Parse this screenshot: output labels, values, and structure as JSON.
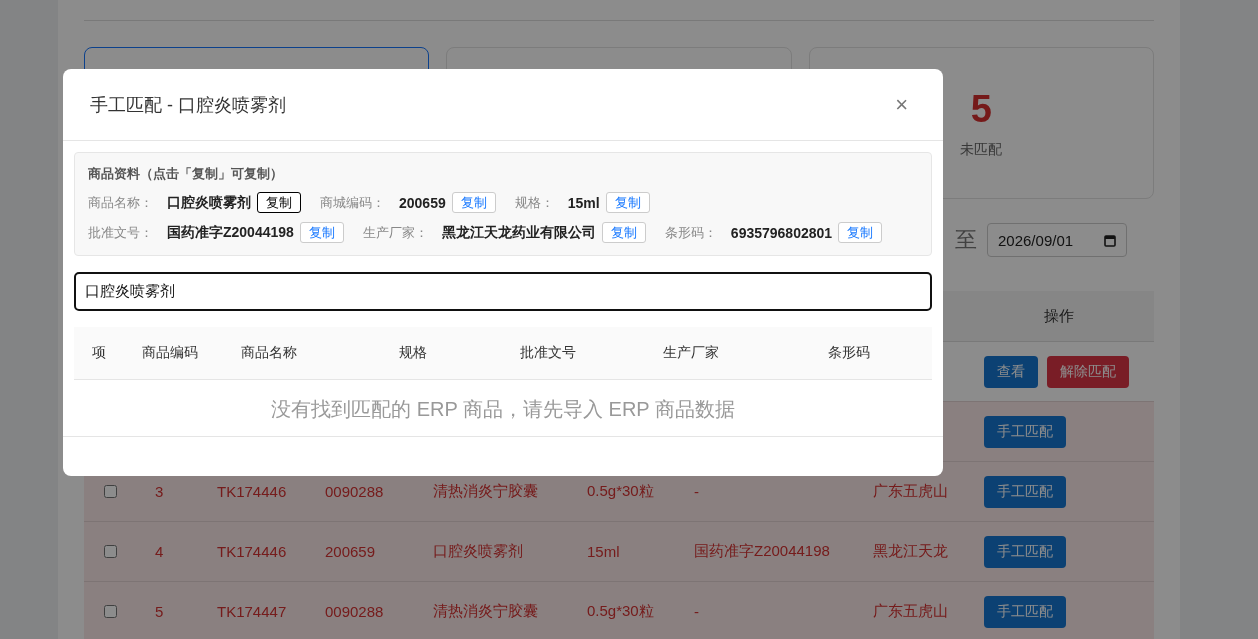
{
  "stat_cards": [
    {
      "selected": true
    },
    {
      "selected": false
    },
    {
      "selected": false,
      "value": "5",
      "label": "未匹配"
    }
  ],
  "date_filter": {
    "separator": "至",
    "end_date": "2026/09/01"
  },
  "table": {
    "action_header": "操作",
    "rows": [
      {
        "kind": "matched",
        "actions": [
          {
            "kind": "primary",
            "label": "查看"
          },
          {
            "kind": "danger",
            "label": "解除匹配"
          }
        ]
      },
      {
        "kind": "unmatched",
        "actions": [
          {
            "kind": "primary",
            "label": "手工匹配"
          }
        ]
      },
      {
        "kind": "unmatched",
        "checked": false,
        "cells": [
          "3",
          "TK174446",
          "0090288",
          "清热消炎宁胶囊",
          "0.5g*30粒",
          "-",
          "广东五虎山"
        ],
        "actions": [
          {
            "kind": "primary",
            "label": "手工匹配"
          }
        ]
      },
      {
        "kind": "unmatched",
        "checked": false,
        "cells": [
          "4",
          "TK174446",
          "200659",
          "口腔炎喷雾剂",
          "15ml",
          "国药准字Z20044198",
          "黑龙江天龙"
        ],
        "actions": [
          {
            "kind": "primary",
            "label": "手工匹配"
          }
        ]
      },
      {
        "kind": "unmatched",
        "checked": false,
        "cells": [
          "5",
          "TK174447",
          "0090288",
          "清热消炎宁胶囊",
          "0.5g*30粒",
          "-",
          "广东五虎山"
        ],
        "actions": [
          {
            "kind": "primary",
            "label": "手工匹配"
          }
        ]
      }
    ]
  },
  "modal": {
    "title": "手工匹配 - 口腔炎喷雾剂",
    "close": "×",
    "info": {
      "heading": "商品资料（点击「复制」可复制）",
      "lines": [
        [
          {
            "label": "商品名称：",
            "value": "口腔炎喷雾剂",
            "copy": "复制",
            "focused": true
          },
          {
            "label": "商城编码：",
            "value": "200659",
            "copy": "复制",
            "focused": false
          },
          {
            "label": "规格：",
            "value": "15ml",
            "copy": "复制",
            "focused": false
          }
        ],
        [
          {
            "label": "批准文号：",
            "value": "国药准字Z20044198",
            "copy": "复制",
            "focused": false
          },
          {
            "label": "生产厂家：",
            "value": "黑龙江天龙药业有限公司",
            "copy": "复制",
            "focused": false
          },
          {
            "label": "条形码：",
            "value": "6935796802801",
            "copy": "复制",
            "focused": false
          }
        ]
      ]
    },
    "search": {
      "value": "口腔炎喷雾剂"
    },
    "columns": [
      "项",
      "商品编码",
      "商品名称",
      "规格",
      "批准文号",
      "生产厂家",
      "条形码"
    ],
    "empty_text": "没有找到匹配的 ERP 商品，请先导入 ERP 商品数据"
  }
}
